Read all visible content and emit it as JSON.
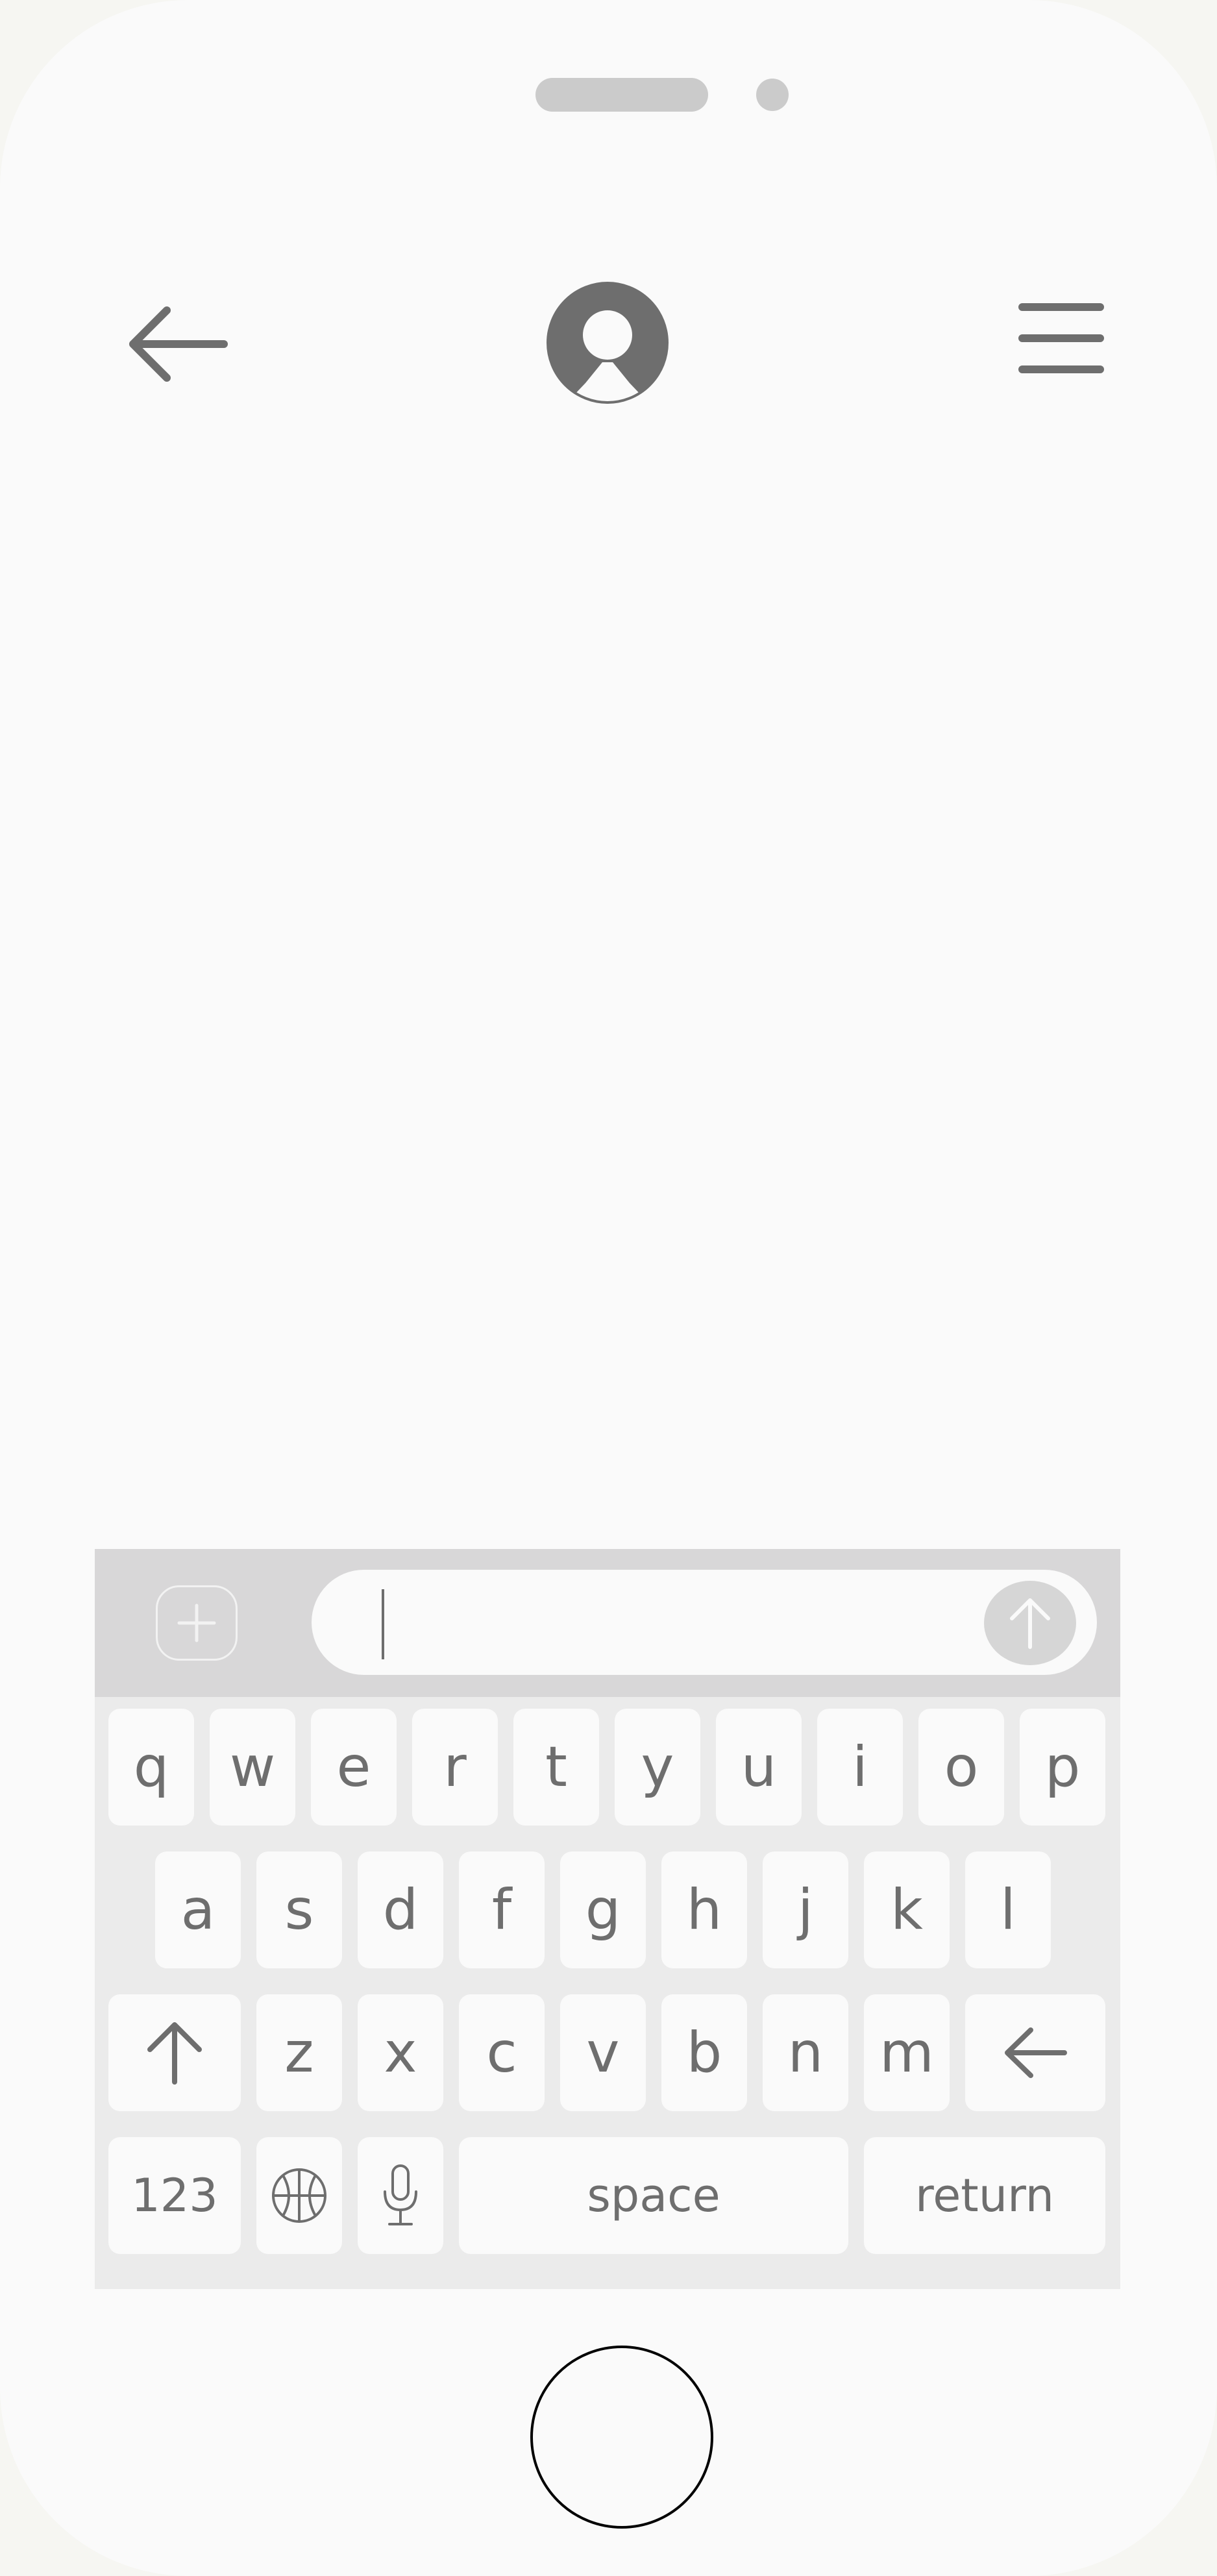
{
  "colors": {
    "screen_bg": "#fafafa",
    "icon_gray": "#6e6e6e",
    "composer_bg": "#d8d7d8",
    "keyboard_bg": "#ebebeb",
    "key_bg": "#fafafa",
    "send_bg": "#d6d6d6"
  },
  "icons": {
    "back": "arrow-left-icon",
    "avatar": "user-avatar-icon",
    "menu": "hamburger-menu-icon",
    "attach": "plus-icon",
    "send": "arrow-up-icon",
    "shift": "arrow-up-icon",
    "delete": "arrow-left-icon",
    "emoji": "globe-icon",
    "mic": "microphone-icon"
  },
  "composer": {
    "text": ""
  },
  "keyboard": {
    "row1": [
      "q",
      "w",
      "e",
      "r",
      "t",
      "y",
      "u",
      "i",
      "o",
      "p"
    ],
    "row2": [
      "a",
      "s",
      "d",
      "f",
      "g",
      "h",
      "j",
      "k",
      "l"
    ],
    "row3": [
      "z",
      "x",
      "c",
      "v",
      "b",
      "n",
      "m"
    ],
    "numbers_label": "123",
    "space_label": "space",
    "return_label": "return"
  }
}
